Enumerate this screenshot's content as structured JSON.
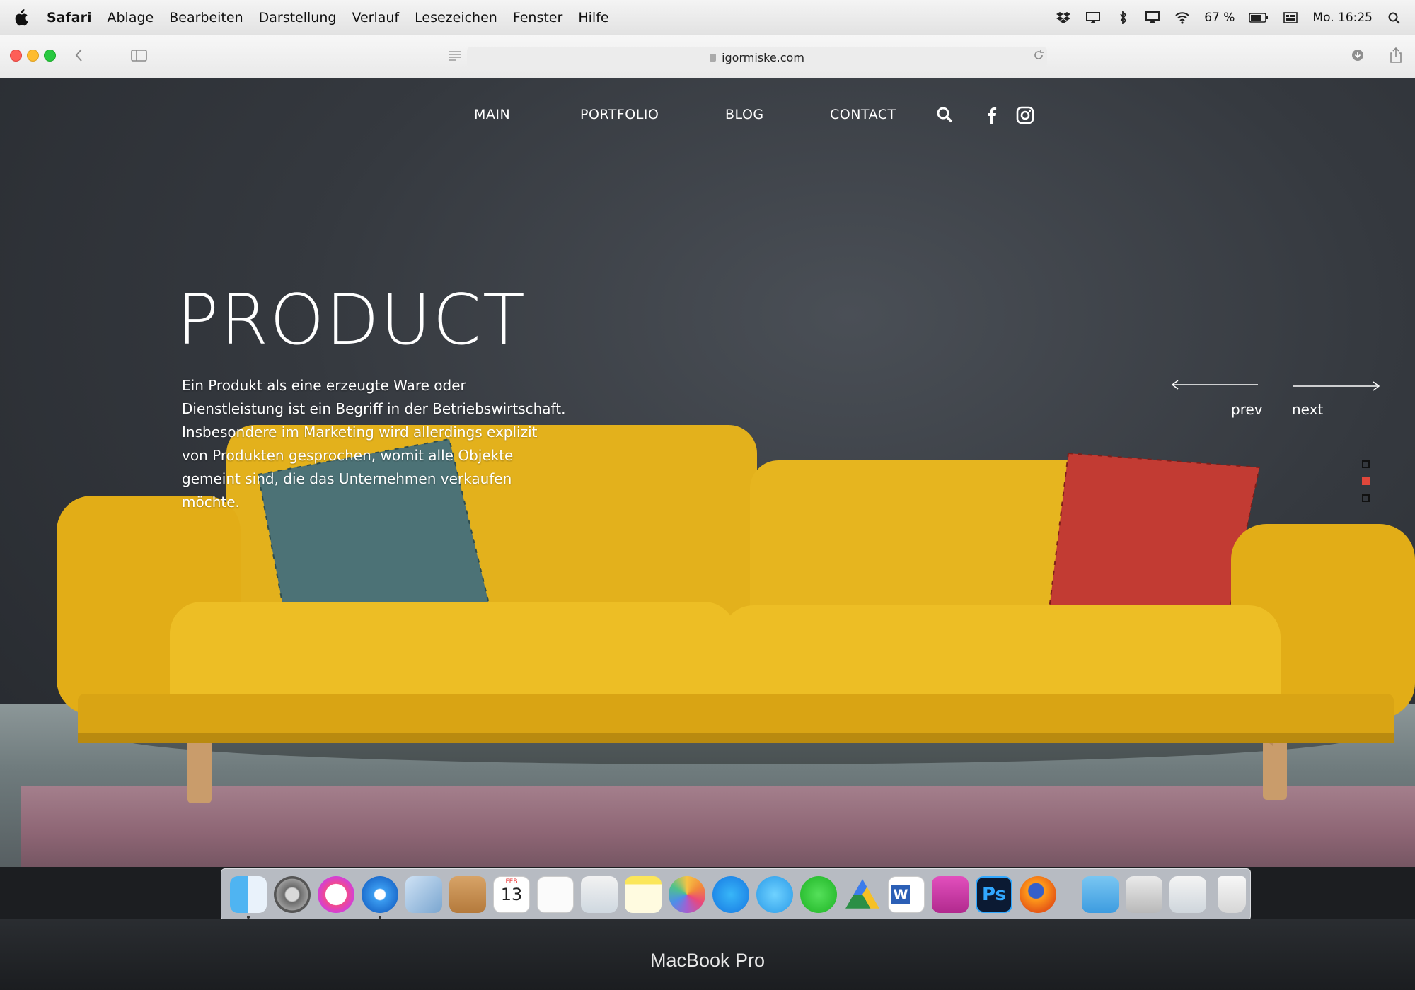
{
  "menubar": {
    "app": "Safari",
    "items": [
      "Ablage",
      "Bearbeiten",
      "Darstellung",
      "Verlauf",
      "Lesezeichen",
      "Fenster",
      "Hilfe"
    ],
    "battery": "67 %",
    "clock": "Mo. 16:25"
  },
  "browser": {
    "url": "igormiske.com"
  },
  "site": {
    "nav": {
      "main": "MAIN",
      "portfolio": "PORTFOLIO",
      "blog": "BLOG",
      "contact": "CONTACT"
    },
    "hero": {
      "title": "PRODUCT",
      "lines": [
        "Ein Produkt als eine erzeugte Ware oder",
        "Dienstleistung ist ein Begriff in der Betriebswirtschaft.",
        "Insbesondere im Marketing wird allerdings explizit",
        "von Produkten gesprochen, womit alle Objekte",
        "gemeint sind, die das Unternehmen verkaufen",
        "möchte."
      ]
    },
    "slider": {
      "prev": "prev",
      "next": "next",
      "active_slide": 2,
      "slide_count": 3
    },
    "colors": {
      "accent": "#e0473b",
      "sofa": "#e8b61d",
      "wall": "#35393f"
    }
  },
  "dock": {
    "apps": [
      "Finder",
      "System Preferences",
      "iTunes",
      "Safari",
      "Mail",
      "Contacts",
      "Calendar",
      "Reminders",
      "Preview",
      "Notes",
      "Photos",
      "App Store",
      "Messages",
      "WeChat",
      "Google Drive",
      "Word",
      "Photo Booth",
      "Photoshop",
      "Firefox"
    ],
    "calendar": {
      "month": "FEB",
      "day": "13"
    },
    "photoshop_label": "Ps",
    "word_label": "W"
  },
  "device": {
    "brand": "MacBook Pro"
  }
}
